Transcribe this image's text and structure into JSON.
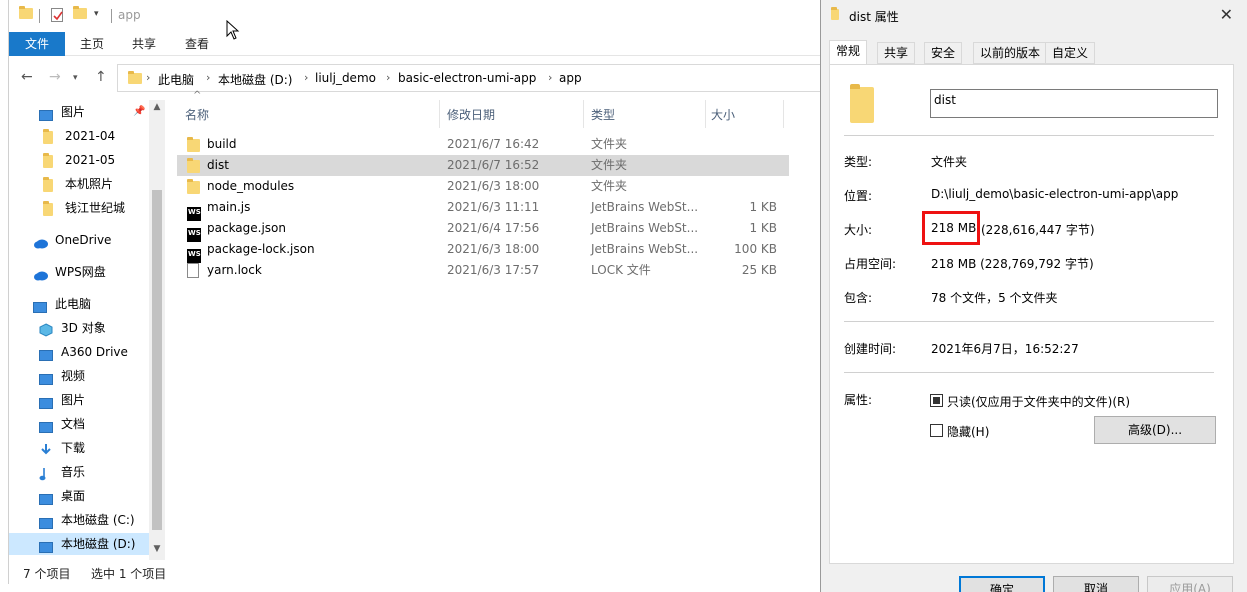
{
  "explorer": {
    "title": "app",
    "ribbon_tabs": [
      "文件",
      "主页",
      "共享",
      "查看"
    ],
    "breadcrumb": [
      "此电脑",
      "本地磁盘 (D:)",
      "liulj_demo",
      "basic-electron-umi-app",
      "app"
    ],
    "nav": [
      {
        "label": "图片",
        "icon": "pictures-icon",
        "pinned": true
      },
      {
        "label": "2021-04",
        "icon": "folder-icon"
      },
      {
        "label": "2021-05",
        "icon": "folder-icon"
      },
      {
        "label": "本机照片",
        "icon": "folder-icon"
      },
      {
        "label": "钱江世纪城",
        "icon": "folder-icon"
      },
      {
        "label": "OneDrive",
        "icon": "onedrive-icon"
      },
      {
        "label": "WPS网盘",
        "icon": "wps-cloud-icon"
      },
      {
        "label": "此电脑",
        "icon": "this-pc-icon"
      },
      {
        "label": "3D 对象",
        "icon": "3d-objects-icon"
      },
      {
        "label": "A360 Drive",
        "icon": "a360-drive-icon"
      },
      {
        "label": "视频",
        "icon": "videos-icon"
      },
      {
        "label": "图片",
        "icon": "pictures-icon"
      },
      {
        "label": "文档",
        "icon": "documents-icon"
      },
      {
        "label": "下载",
        "icon": "downloads-icon"
      },
      {
        "label": "音乐",
        "icon": "music-icon"
      },
      {
        "label": "桌面",
        "icon": "desktop-icon"
      },
      {
        "label": "本地磁盘 (C:)",
        "icon": "drive-c-icon"
      },
      {
        "label": "本地磁盘 (D:)",
        "icon": "drive-d-icon",
        "selected": true
      }
    ],
    "columns": {
      "name": "名称",
      "date": "修改日期",
      "type": "类型",
      "size": "大小"
    },
    "files": [
      {
        "name": "build",
        "date": "2021/6/7 16:42",
        "type": "文件夹",
        "size": "",
        "icon": "folder-icon"
      },
      {
        "name": "dist",
        "date": "2021/6/7 16:52",
        "type": "文件夹",
        "size": "",
        "icon": "folder-icon",
        "selected": true
      },
      {
        "name": "node_modules",
        "date": "2021/6/3 18:00",
        "type": "文件夹",
        "size": "",
        "icon": "folder-icon"
      },
      {
        "name": "main.js",
        "date": "2021/6/3 11:11",
        "type": "JetBrains WebSt...",
        "size": "1 KB",
        "icon": "webstorm-file-icon"
      },
      {
        "name": "package.json",
        "date": "2021/6/4 17:56",
        "type": "JetBrains WebSt...",
        "size": "1 KB",
        "icon": "webstorm-file-icon"
      },
      {
        "name": "package-lock.json",
        "date": "2021/6/3 18:00",
        "type": "JetBrains WebSt...",
        "size": "100 KB",
        "icon": "webstorm-file-icon"
      },
      {
        "name": "yarn.lock",
        "date": "2021/6/3 17:57",
        "type": "LOCK 文件",
        "size": "25 KB",
        "icon": "generic-file-icon"
      }
    ],
    "status": {
      "count": "7 个项目",
      "selected": "选中 1 个项目"
    }
  },
  "props": {
    "title": "dist 属性",
    "tabs": [
      "常规",
      "共享",
      "安全",
      "以前的版本",
      "自定义"
    ],
    "name_value": "dist",
    "rows": {
      "type_label": "类型:",
      "type_value": "文件夹",
      "location_label": "位置:",
      "location_value": "D:\\liulj_demo\\basic-electron-umi-app\\app",
      "size_label": "大小:",
      "size_value_main": "218 MB",
      "size_value_detail": "(228,616,447 字节)",
      "disk_label": "占用空间:",
      "disk_value": "218 MB (228,769,792 字节)",
      "contains_label": "包含:",
      "contains_value": "78 个文件，5 个文件夹",
      "created_label": "创建时间:",
      "created_value": "2021年6月7日，16:52:27",
      "attr_label": "属性:"
    },
    "readonly_label": "只读(仅应用于文件夹中的文件)(R)",
    "hidden_label": "隐藏(H)",
    "advanced_label": "高级(D)...",
    "buttons": {
      "ok": "确定",
      "cancel": "取消",
      "apply": "应用(A)"
    },
    "highlight_color": "#ee1111"
  }
}
